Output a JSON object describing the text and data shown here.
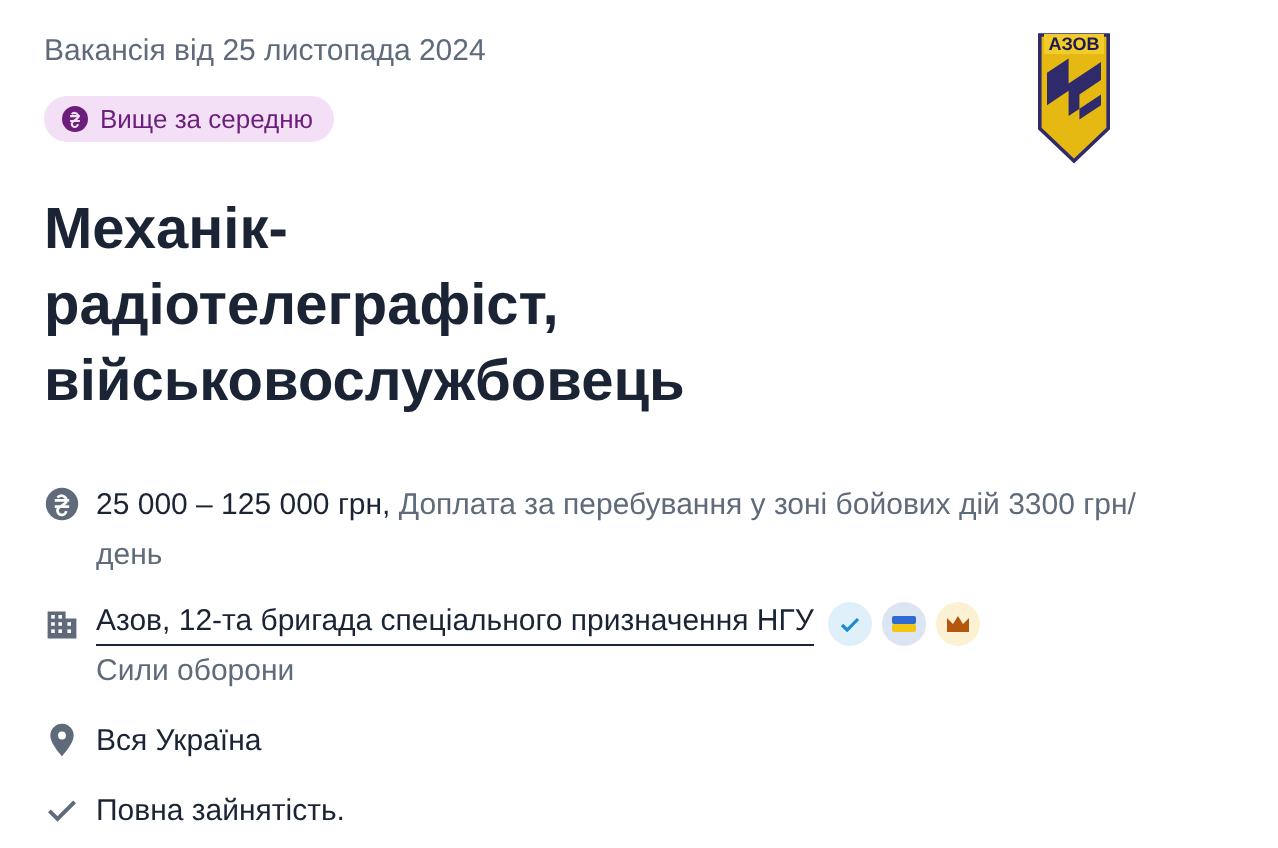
{
  "posted": "Вакансія від 25 листопада 2024",
  "badge": {
    "label": "Вище за середню"
  },
  "logo": {
    "text": "АЗОВ"
  },
  "title": "Механік-радіотелеграфіст, військовослужбовець",
  "details": [
    {
      "kind": "salary",
      "text": "**25 000 – 125 000 грн,** Доплата за перебування у зоні бойових дій 3300 грн/день"
    },
    {
      "kind": "company",
      "text": "Азов, 12-та бригада спеціального призначення НГУ",
      "subtitle": "Сили оборони",
      "verified": true,
      "flag": true,
      "premium": true
    },
    {
      "kind": "location",
      "text": "Вся Україна"
    },
    {
      "kind": "employment",
      "text": "Повна зайнятість."
    }
  ]
}
